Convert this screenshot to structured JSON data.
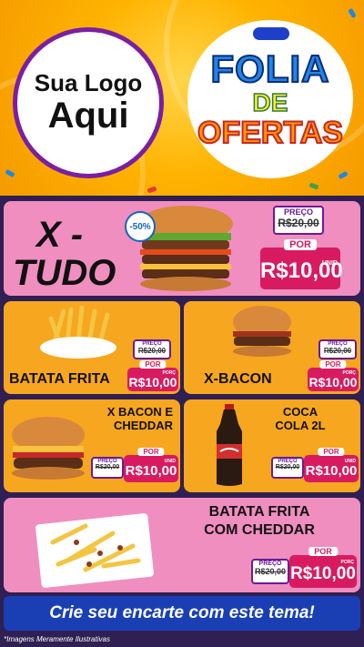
{
  "header": {
    "logo_line1": "Sua Logo",
    "logo_line2": "Aqui",
    "theme_line1": "FOLIA",
    "theme_line2": "DE",
    "theme_line3": "OFERTAS"
  },
  "colors": {
    "header_bg": "#ffb300",
    "card_pink": "#f08ec0",
    "card_orange": "#f7a61f",
    "price_red": "#d81b60",
    "price_purple": "#6a1b9a",
    "footer_blue": "#1a3fb5"
  },
  "labels": {
    "preco": "PREÇO",
    "por": "POR",
    "unid": "UNID",
    "porc": "PORÇ"
  },
  "products": [
    {
      "name_line1": "X -",
      "name_line2": "TUDO",
      "old_price": "R$20,00",
      "new_price": "R$10,00",
      "unit": "UNID",
      "discount": "-50%",
      "icon": "burger-icon"
    },
    {
      "name": "BATATA FRITA",
      "old_price": "R$20,00",
      "new_price": "R$10,00",
      "unit": "PORÇ",
      "icon": "fries-icon"
    },
    {
      "name": "X-BACON",
      "old_price": "R$20,00",
      "new_price": "R$10,00",
      "unit": "PORÇ",
      "icon": "burger-icon"
    },
    {
      "name_line1": "X BACON E",
      "name_line2": "CHEDDAR",
      "old_price": "R$20,00",
      "new_price": "R$10,00",
      "unit": "UNID",
      "icon": "burger-icon"
    },
    {
      "name_line1": "COCA",
      "name_line2": "COLA 2L",
      "old_price": "R$20,00",
      "new_price": "R$10,00",
      "unit": "UNID",
      "icon": "soda-bottle-icon"
    },
    {
      "name_line1": "BATATA FRITA",
      "name_line2": "COM CHEDDAR",
      "old_price": "R$20,00",
      "new_price": "R$10,00",
      "unit": "PORÇ",
      "icon": "fries-icon"
    }
  ],
  "footer": {
    "cta": "Crie seu encarte com este tema!",
    "disclaimer": "*Imagens Meramente Ilustrativas"
  }
}
